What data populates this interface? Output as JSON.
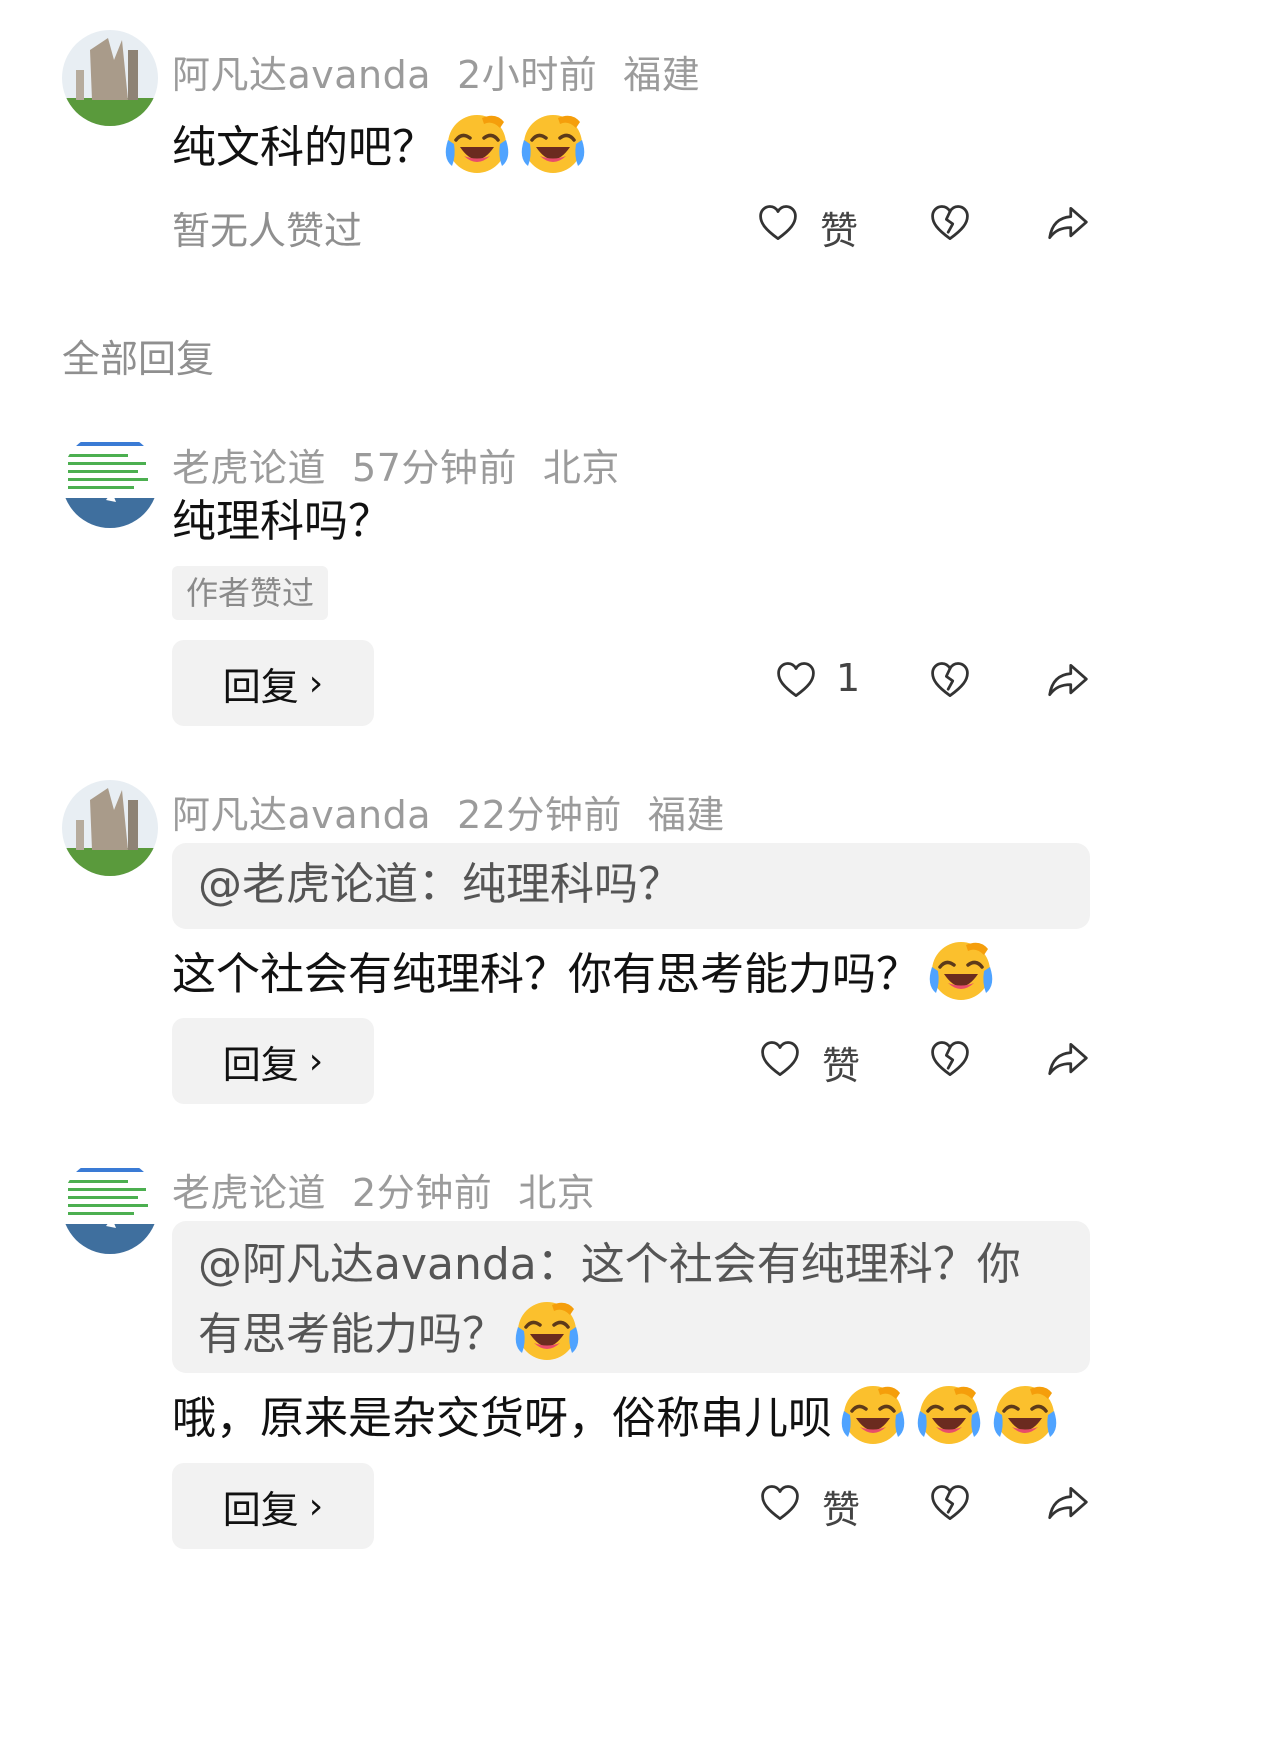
{
  "top_comment": {
    "user": "阿凡达avanda",
    "time": "2小时前",
    "location": "福建",
    "text": "纯文科的吧？",
    "likes_status": "暂无人赞过",
    "like_label": "赞"
  },
  "section_title": "全部回复",
  "replies": [
    {
      "user": "老虎论道",
      "time": "57分钟前",
      "location": "北京",
      "text": "纯理科吗？",
      "badge": "作者赞过",
      "reply_label": "回复",
      "like_count": "1"
    },
    {
      "user": "阿凡达avanda",
      "time": "22分钟前",
      "location": "福建",
      "quote": "@老虎论道：纯理科吗？",
      "text": "这个社会有纯理科？你有思考能力吗？",
      "reply_label": "回复",
      "like_label": "赞"
    },
    {
      "user": "老虎论道",
      "time": "2分钟前",
      "location": "北京",
      "quote_line1": "@阿凡达avanda：这个社会有纯理科？你",
      "quote_line2": "有思考能力吗？",
      "text": "哦，原来是杂交货呀，俗称串儿呗",
      "reply_label": "回复",
      "like_label": "赞"
    }
  ],
  "icons": {
    "like": "heart-icon",
    "dislike": "broken-heart-icon",
    "share": "share-icon",
    "emoji": "laughing-crying-emoji"
  },
  "colors": {
    "meta": "#9b9b9b",
    "button_bg": "#f2f2f2",
    "text": "#111111"
  }
}
